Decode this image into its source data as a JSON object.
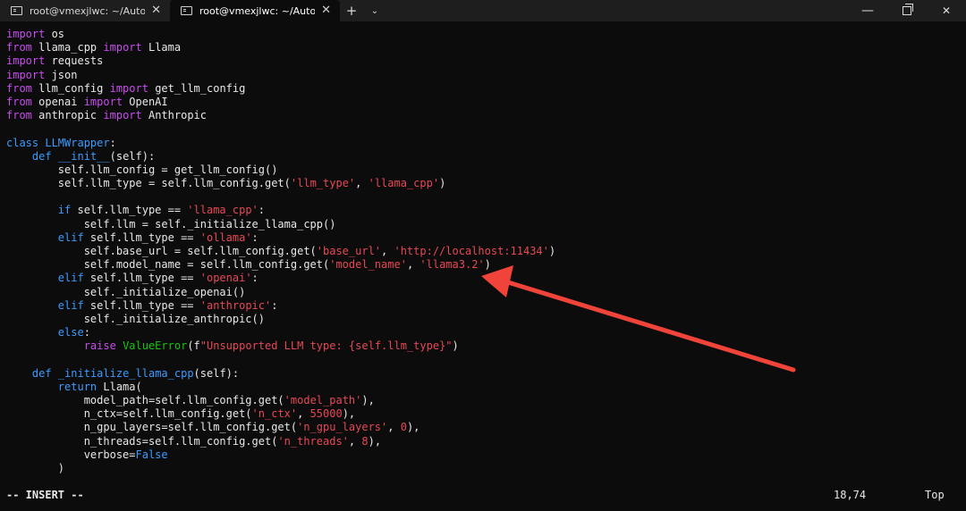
{
  "tabs": [
    {
      "title": "root@vmexjlwc: ~/Automated",
      "active": false,
      "icon": "terminal-icon"
    },
    {
      "title": "root@vmexjlwc: ~/Automated",
      "active": true,
      "icon": "terminal-icon"
    }
  ],
  "tab_close_glyph": "✕",
  "new_tab_glyph": "+",
  "dropdown_glyph": "⌄",
  "window_controls": {
    "minimize": "—",
    "close": "✕"
  },
  "code_lines": [
    [
      [
        "kw",
        "import"
      ],
      [
        "t",
        " os"
      ]
    ],
    [
      [
        "kw",
        "from"
      ],
      [
        "t",
        " llama_cpp "
      ],
      [
        "kw",
        "import"
      ],
      [
        "t",
        " Llama"
      ]
    ],
    [
      [
        "kw",
        "import"
      ],
      [
        "t",
        " requests"
      ]
    ],
    [
      [
        "kw",
        "import"
      ],
      [
        "t",
        " json"
      ]
    ],
    [
      [
        "kw",
        "from"
      ],
      [
        "t",
        " llm_config "
      ],
      [
        "kw",
        "import"
      ],
      [
        "t",
        " get_llm_config"
      ]
    ],
    [
      [
        "kw",
        "from"
      ],
      [
        "t",
        " openai "
      ],
      [
        "kw",
        "import"
      ],
      [
        "t",
        " OpenAI"
      ]
    ],
    [
      [
        "kw",
        "from"
      ],
      [
        "t",
        " anthropic "
      ],
      [
        "kw",
        "import"
      ],
      [
        "t",
        " Anthropic"
      ]
    ],
    [],
    [
      [
        "kw2",
        "class"
      ],
      [
        "t",
        " "
      ],
      [
        "cls",
        "LLMWrapper"
      ],
      [
        "t",
        ":"
      ]
    ],
    [
      [
        "t",
        "    "
      ],
      [
        "kw2",
        "def"
      ],
      [
        "t",
        " "
      ],
      [
        "fn",
        "__init__"
      ],
      [
        "t",
        "(self):"
      ]
    ],
    [
      [
        "t",
        "        self.llm_config = get_llm_config()"
      ]
    ],
    [
      [
        "t",
        "        self.llm_type = self.llm_config.get("
      ],
      [
        "str",
        "'llm_type'"
      ],
      [
        "t",
        ", "
      ],
      [
        "str",
        "'llama_cpp'"
      ],
      [
        "t",
        ")"
      ]
    ],
    [],
    [
      [
        "t",
        "        "
      ],
      [
        "kw2",
        "if"
      ],
      [
        "t",
        " self.llm_type == "
      ],
      [
        "str",
        "'llama_cpp'"
      ],
      [
        "t",
        ":"
      ]
    ],
    [
      [
        "t",
        "            self.llm = self._initialize_llama_cpp()"
      ]
    ],
    [
      [
        "t",
        "        "
      ],
      [
        "kw2",
        "elif"
      ],
      [
        "t",
        " self.llm_type == "
      ],
      [
        "str",
        "'ollama'"
      ],
      [
        "t",
        ":"
      ]
    ],
    [
      [
        "t",
        "            self.base_url = self.llm_config.get("
      ],
      [
        "str",
        "'base_url'"
      ],
      [
        "t",
        ", "
      ],
      [
        "str",
        "'http://localhost:11434'"
      ],
      [
        "t",
        ")"
      ]
    ],
    [
      [
        "t",
        "            self.model_name = self.llm_config.get("
      ],
      [
        "str",
        "'model_name'"
      ],
      [
        "t",
        ", "
      ],
      [
        "str",
        "'llama3.2'"
      ],
      [
        "t",
        ")"
      ]
    ],
    [
      [
        "t",
        "        "
      ],
      [
        "kw2",
        "elif"
      ],
      [
        "t",
        " self.llm_type == "
      ],
      [
        "str",
        "'openai'"
      ],
      [
        "t",
        ":"
      ]
    ],
    [
      [
        "t",
        "            self._initialize_openai()"
      ]
    ],
    [
      [
        "t",
        "        "
      ],
      [
        "kw2",
        "elif"
      ],
      [
        "t",
        " self.llm_type == "
      ],
      [
        "str",
        "'anthropic'"
      ],
      [
        "t",
        ":"
      ]
    ],
    [
      [
        "t",
        "            self._initialize_anthropic()"
      ]
    ],
    [
      [
        "t",
        "        "
      ],
      [
        "kw2",
        "else"
      ],
      [
        "t",
        ":"
      ]
    ],
    [
      [
        "t",
        "            "
      ],
      [
        "kw",
        "raise"
      ],
      [
        "t",
        " "
      ],
      [
        "bi",
        "ValueError"
      ],
      [
        "t",
        "(f"
      ],
      [
        "str",
        "\"Unsupported LLM type: {self.llm_type}\""
      ],
      [
        "t",
        ")"
      ]
    ],
    [],
    [
      [
        "t",
        "    "
      ],
      [
        "kw2",
        "def"
      ],
      [
        "t",
        " "
      ],
      [
        "fn",
        "_initialize_llama_cpp"
      ],
      [
        "t",
        "(self):"
      ]
    ],
    [
      [
        "t",
        "        "
      ],
      [
        "kw2",
        "return"
      ],
      [
        "t",
        " Llama("
      ]
    ],
    [
      [
        "t",
        "            model_path=self.llm_config.get("
      ],
      [
        "str",
        "'model_path'"
      ],
      [
        "t",
        "),"
      ]
    ],
    [
      [
        "t",
        "            n_ctx=self.llm_config.get("
      ],
      [
        "str",
        "'n_ctx'"
      ],
      [
        "t",
        ", "
      ],
      [
        "num",
        "55000"
      ],
      [
        "t",
        "),"
      ]
    ],
    [
      [
        "t",
        "            n_gpu_layers=self.llm_config.get("
      ],
      [
        "str",
        "'n_gpu_layers'"
      ],
      [
        "t",
        ", "
      ],
      [
        "num",
        "0"
      ],
      [
        "t",
        "),"
      ]
    ],
    [
      [
        "t",
        "            n_threads=self.llm_config.get("
      ],
      [
        "str",
        "'n_threads'"
      ],
      [
        "t",
        ", "
      ],
      [
        "num",
        "8"
      ],
      [
        "t",
        "),"
      ]
    ],
    [
      [
        "t",
        "            verbose="
      ],
      [
        "kw2",
        "False"
      ]
    ],
    [
      [
        "t",
        "        )"
      ]
    ]
  ],
  "status": {
    "mode": "-- INSERT --",
    "cursor_position": "18,74",
    "scroll_position": "Top"
  },
  "annotation": {
    "type": "red-arrow",
    "color": "#f0443a"
  }
}
